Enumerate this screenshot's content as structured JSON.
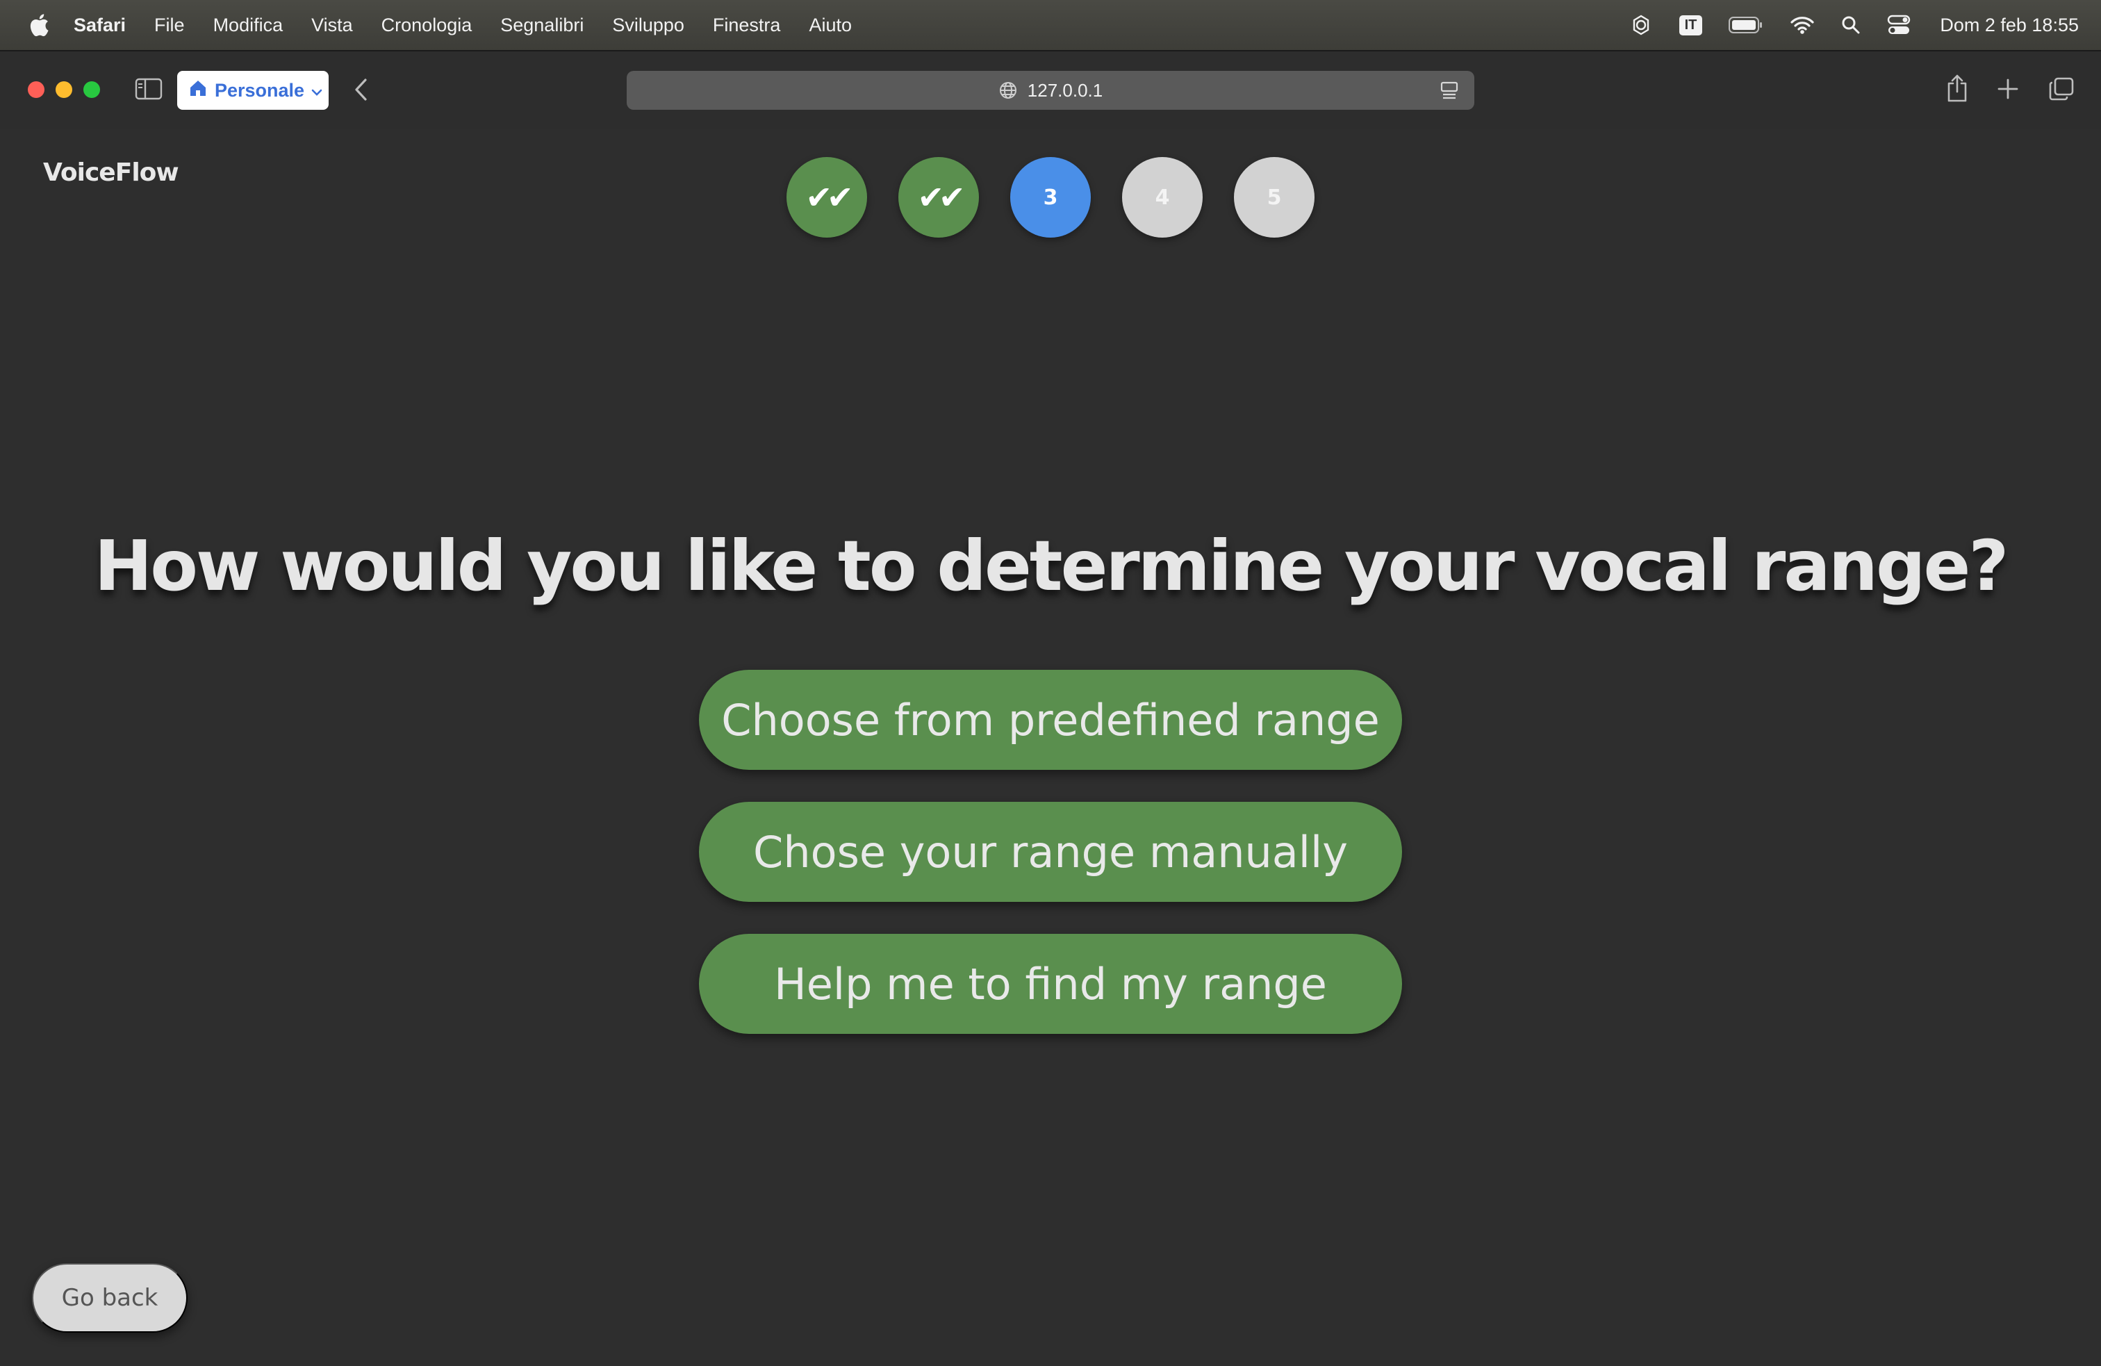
{
  "menubar": {
    "app_name": "Safari",
    "items": [
      "File",
      "Modifica",
      "Vista",
      "Cronologia",
      "Segnalibri",
      "Sviluppo",
      "Finestra",
      "Aiuto"
    ],
    "keyboard_layout": "IT",
    "clock": "Dom 2 feb  18:55"
  },
  "browser": {
    "profile_label": "Personale",
    "url": "127.0.0.1"
  },
  "app": {
    "logo": "VoiceFlow",
    "steps": [
      {
        "label": "✔✔",
        "state": "done"
      },
      {
        "label": "✔✔",
        "state": "done"
      },
      {
        "label": "3",
        "state": "current"
      },
      {
        "label": "4",
        "state": "todo"
      },
      {
        "label": "5",
        "state": "todo"
      }
    ],
    "headline": "How would you like to determine your vocal range?",
    "options": [
      "Choose from predefined range",
      "Chose your range manually",
      "Help me to find my range"
    ],
    "go_back_label": "Go back"
  },
  "colors": {
    "accent_green": "#5a8f4e",
    "current_step_blue": "#4a8fe8",
    "background": "#2e2e2e"
  }
}
